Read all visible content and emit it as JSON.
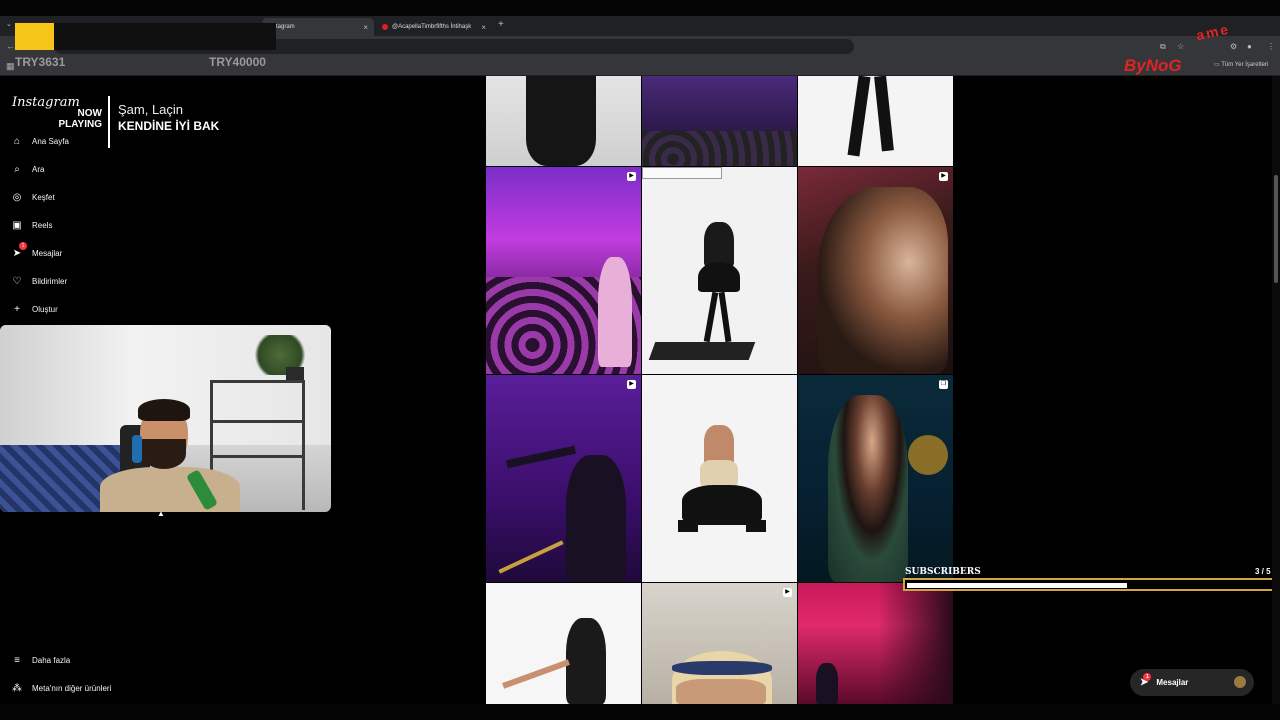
{
  "browser": {
    "tabs": [
      {
        "label": "Instagram",
        "active": true
      },
      {
        "label": "@AcapellaTimbrfifths İntihaşk",
        "active": false
      }
    ],
    "bookmark_texts": [
      "TRY3631",
      "TRY40000"
    ],
    "all_bookmarks_label": "Tüm Yer İşaretleri"
  },
  "brand": {
    "text": "ByNoG",
    "super": "ame"
  },
  "instagram": {
    "logo": "Instagram",
    "now_playing": {
      "label_line1": "NOW",
      "label_line2": "PLAYING",
      "artist": "Şam, Laçin",
      "song": "KENDİNE İYİ BAK"
    },
    "nav": [
      {
        "label": "Ana Sayfa",
        "icon": "home-icon"
      },
      {
        "label": "Ara",
        "icon": "search-icon"
      },
      {
        "label": "Keşfet",
        "icon": "explore-icon"
      },
      {
        "label": "Reels",
        "icon": "reels-icon"
      },
      {
        "label": "Mesajlar",
        "icon": "messenger-icon",
        "badge": "1"
      },
      {
        "label": "Bildirimler",
        "icon": "heart-icon"
      },
      {
        "label": "Oluştur",
        "icon": "plus-icon"
      }
    ],
    "bottom": [
      {
        "label": "Daha fazla",
        "icon": "menu-icon"
      },
      {
        "label": "Meta'nın diğer ürünleri",
        "icon": "meta-icon"
      }
    ],
    "messages_pill": {
      "label": "Mesajlar",
      "badge": "1"
    }
  },
  "subscribers": {
    "label": "SUBSCRIBERS",
    "count": "3 / 5",
    "progress": 0.6
  },
  "colors": {
    "accent_red": "#e02424",
    "badge_red": "#ff3040",
    "progress_border": "#d4a441"
  }
}
